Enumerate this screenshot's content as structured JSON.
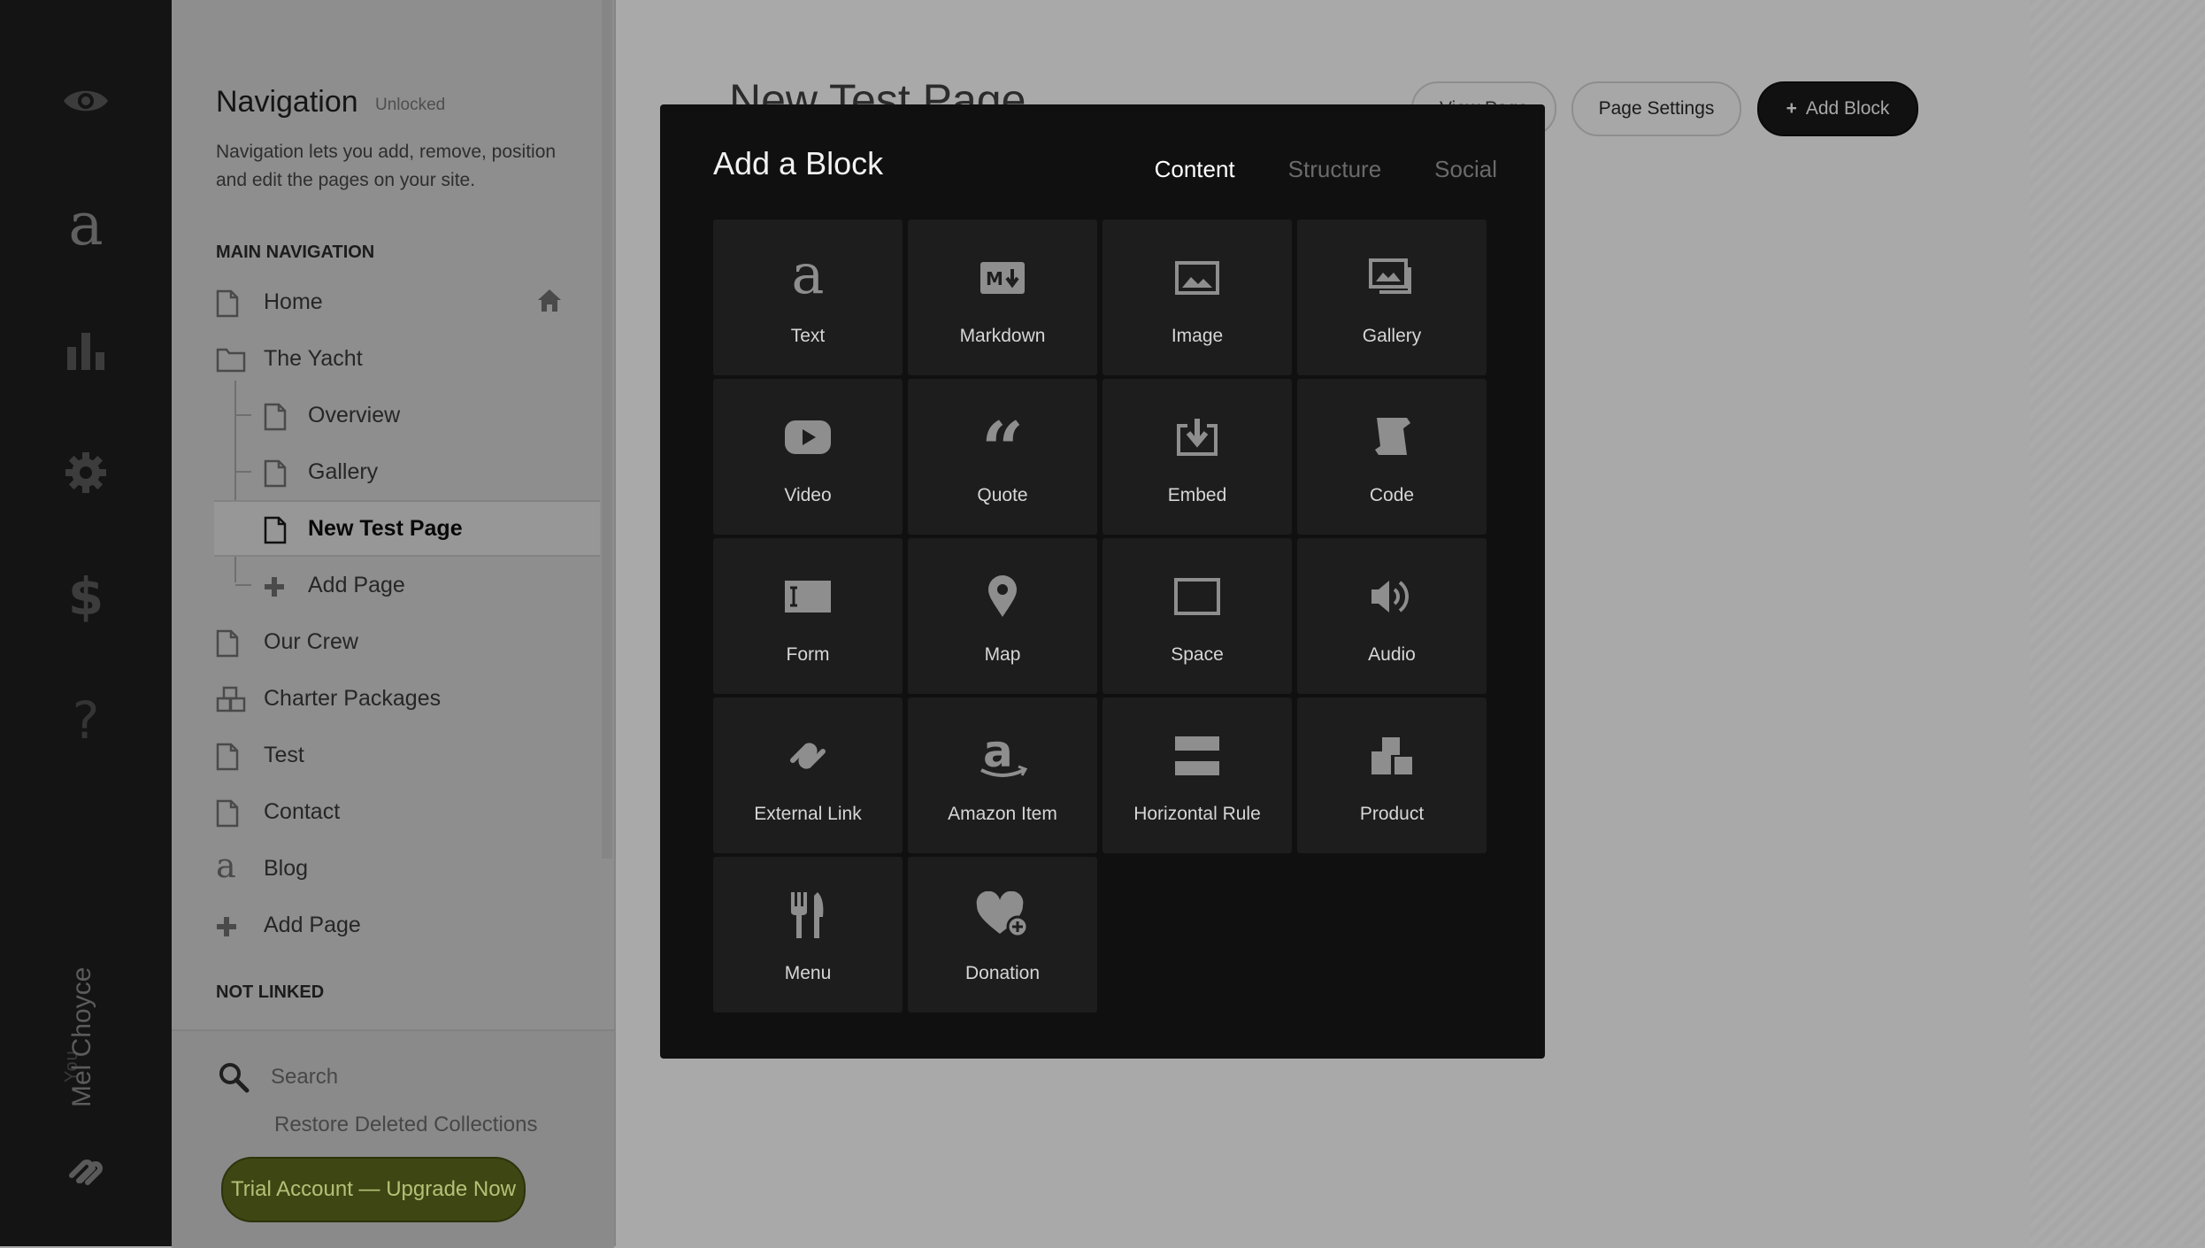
{
  "rail": {
    "user_label": "You",
    "user_name": "Mel Choyce",
    "icons": [
      "eye-icon",
      "squarespace-a-icon",
      "analytics-icon",
      "settings-icon",
      "commerce-icon",
      "help-icon",
      "squarespace-logo-icon"
    ]
  },
  "navigation": {
    "title": "Navigation",
    "status": "Unlocked",
    "description": "Navigation lets you add, remove, position and edit the pages on your site.",
    "main_section": "MAIN NAVIGATION",
    "not_linked_section": "NOT LINKED",
    "items": [
      {
        "label": "Home",
        "icon": "page-icon"
      },
      {
        "label": "The Yacht",
        "icon": "folder-icon"
      },
      {
        "label": "Overview",
        "icon": "page-icon"
      },
      {
        "label": "Gallery",
        "icon": "page-icon"
      },
      {
        "label": "New Test Page",
        "icon": "page-icon"
      },
      {
        "label": "Add Page",
        "icon": "plus-icon"
      },
      {
        "label": "Our Crew",
        "icon": "page-icon"
      },
      {
        "label": "Charter Packages",
        "icon": "products-icon"
      },
      {
        "label": "Test",
        "icon": "page-icon"
      },
      {
        "label": "Contact",
        "icon": "page-icon"
      },
      {
        "label": "Blog",
        "icon": "blog-icon"
      },
      {
        "label": "Add Page",
        "icon": "plus-icon"
      }
    ],
    "search_label": "Search",
    "restore_label": "Restore Deleted Collections",
    "trial_button": "Trial Account — Upgrade Now"
  },
  "page": {
    "title": "New Test Page",
    "view_page": "View Page",
    "page_settings": "Page Settings",
    "add_block": "Add Block"
  },
  "modal": {
    "title": "Add a Block",
    "tabs": [
      "Content",
      "Structure",
      "Social"
    ],
    "active_tab": "Content",
    "blocks": [
      {
        "label": "Text",
        "icon": "text-icon"
      },
      {
        "label": "Markdown",
        "icon": "markdown-icon"
      },
      {
        "label": "Image",
        "icon": "image-icon"
      },
      {
        "label": "Gallery",
        "icon": "gallery-icon"
      },
      {
        "label": "Video",
        "icon": "video-icon"
      },
      {
        "label": "Quote",
        "icon": "quote-icon"
      },
      {
        "label": "Embed",
        "icon": "embed-icon"
      },
      {
        "label": "Code",
        "icon": "code-icon"
      },
      {
        "label": "Form",
        "icon": "form-icon"
      },
      {
        "label": "Map",
        "icon": "map-pin-icon"
      },
      {
        "label": "Space",
        "icon": "space-icon"
      },
      {
        "label": "Audio",
        "icon": "audio-icon"
      },
      {
        "label": "External Link",
        "icon": "link-icon"
      },
      {
        "label": "Amazon Item",
        "icon": "amazon-icon"
      },
      {
        "label": "Horizontal Rule",
        "icon": "horizontal-rule-icon"
      },
      {
        "label": "Product",
        "icon": "product-icon"
      },
      {
        "label": "Menu",
        "icon": "menu-fork-knife-icon"
      },
      {
        "label": "Donation",
        "icon": "donation-heart-icon"
      }
    ]
  },
  "colors": {
    "overlay_bg": "#a9a9a9",
    "modal_bg": "#101010",
    "block_bg": "#1d1d1d",
    "trial_green": "#3e4713"
  }
}
